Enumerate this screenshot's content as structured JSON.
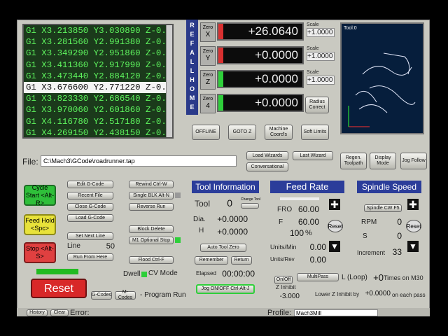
{
  "gcode": {
    "lines": [
      "G1 X3.213850 Y3.030890 Z-0.1000",
      "G1 X3.281560 Y2.991380 Z-0.1000",
      "G1 X3.349290 Y2.951860 Z-0.1000",
      "G1 X3.411360 Y2.917990 Z-0.1000",
      "G1 X3.473440 Y2.884120 Z-0.1000",
      "G1 X3.676600 Y2.771220 Z-0.1000",
      "G1 X3.823330 Y2.686540 Z-0.1000",
      "G1 X3.970060 Y2.601860 Z-0.1000",
      "G1 X4.116780 Y2.517180 Z-0.1000",
      "G1 X4.269150 Y2.438150 Z-0.1000"
    ],
    "current_index": 5
  },
  "ref_all_home": "REF ALL HOME",
  "axes": [
    {
      "zero_label": "Zero",
      "axis": "X",
      "value": "+26.0640",
      "scale": "+1.0000",
      "bar_color": "#d93030"
    },
    {
      "zero_label": "Zero",
      "axis": "Y",
      "value": "+0.0000",
      "scale": "+1.0000",
      "bar_color": "#d93030"
    },
    {
      "zero_label": "Zero",
      "axis": "Z",
      "value": "+0.0000",
      "scale": "+1.0000",
      "bar_color": "#2ecf3a"
    },
    {
      "zero_label": "Zero",
      "axis": "4",
      "value": "+0.0000",
      "scale": "",
      "bar_color": "#2ecf3a"
    }
  ],
  "scale_label": "Scale",
  "radius_correct": "Radius Correct",
  "toolpath_label": "Tool:0",
  "mid_buttons": [
    "OFFLINE",
    "GOTO Z",
    "Machine Coord's",
    "Soft Limits"
  ],
  "toolpath_buttons": [
    "Regen. Toolpath",
    "Display Mode",
    "Jog Follow"
  ],
  "file": {
    "label": "File:",
    "path": "C:\\Mach3\\GCode\\roadrunner.tap"
  },
  "wizard_buttons": [
    "Load Wizards",
    "Last Wizard",
    "Conversational"
  ],
  "left_buttons": {
    "cycle_start": "Cycle Start <Alt-R>",
    "feed_hold": "Feed Hold <Spc>",
    "stop": "Stop <Alt-S>",
    "reset": "Reset"
  },
  "gcode_buttons": [
    "Edit G-Code",
    "Recent File",
    "Close G-Code",
    "Load G-Code",
    "Set Next Line",
    "Run From Here"
  ],
  "line_label": "Line",
  "line_value": "50",
  "right_col_buttons": [
    "Rewind Ctrl-W",
    "Single BLK Alt-N",
    "Reverse Run",
    "Block Delete",
    "M1 Optional Stop",
    "Flood Ctrl-F"
  ],
  "dwell_label": "Dwell",
  "cv_mode": "CV Mode",
  "gcodes_btn": "G-Codes",
  "mcodes_btn": "M-Codes",
  "program_run": "- Program Run",
  "tool_info": {
    "title": "Tool Information",
    "tool_label": "Tool",
    "tool_value": "0",
    "change_label": "Change Tool",
    "dia_label": "Dia.",
    "dia_value": "+0.0000",
    "h_label": "H",
    "h_value": "+0.0000",
    "auto_tool_zero": "Auto Tool Zero",
    "remember": "Remember",
    "return": "Return",
    "elapsed_label": "Elapsed",
    "elapsed_value": "00:00:00",
    "jog_toggle": "Jog ON/OFF Ctrl-Alt-J"
  },
  "feed_rate": {
    "title": "Feed Rate",
    "fro_label": "FRO",
    "fro_value": "60.00",
    "f_label": "F",
    "f_value": "60.00",
    "percent": "100",
    "pct_sign": "%",
    "units_min_label": "Units/Min",
    "units_min_value": "0.00",
    "units_rev_label": "Units/Rev",
    "units_rev_value": "0.00",
    "reset": "Reset"
  },
  "spindle": {
    "title": "Spindle Speed",
    "cw_btn": "Spindle CW F5",
    "rpm_label": "RPM",
    "rpm_value": "0",
    "s_label": "S",
    "s_value": "0",
    "increment_label": "Increment",
    "increment_value": "33",
    "reset": "Reset"
  },
  "bottom": {
    "on_off": "On/Off",
    "z_inhibit": "Z Inhibit",
    "z_value": "-3.000",
    "multipass": "MultiPass",
    "loop_label": "L (Loop)",
    "times_value": "+0",
    "times_label": "Times on M30",
    "lower_z_label": "Lower Z Inhibit by",
    "lower_z_value": "+0.0000",
    "each_pass": "on each pass"
  },
  "status": {
    "history": "History",
    "clear": "Clear",
    "error_label": "Error:",
    "profile_label": "Profile:",
    "profile_value": "Mach3Mill"
  }
}
